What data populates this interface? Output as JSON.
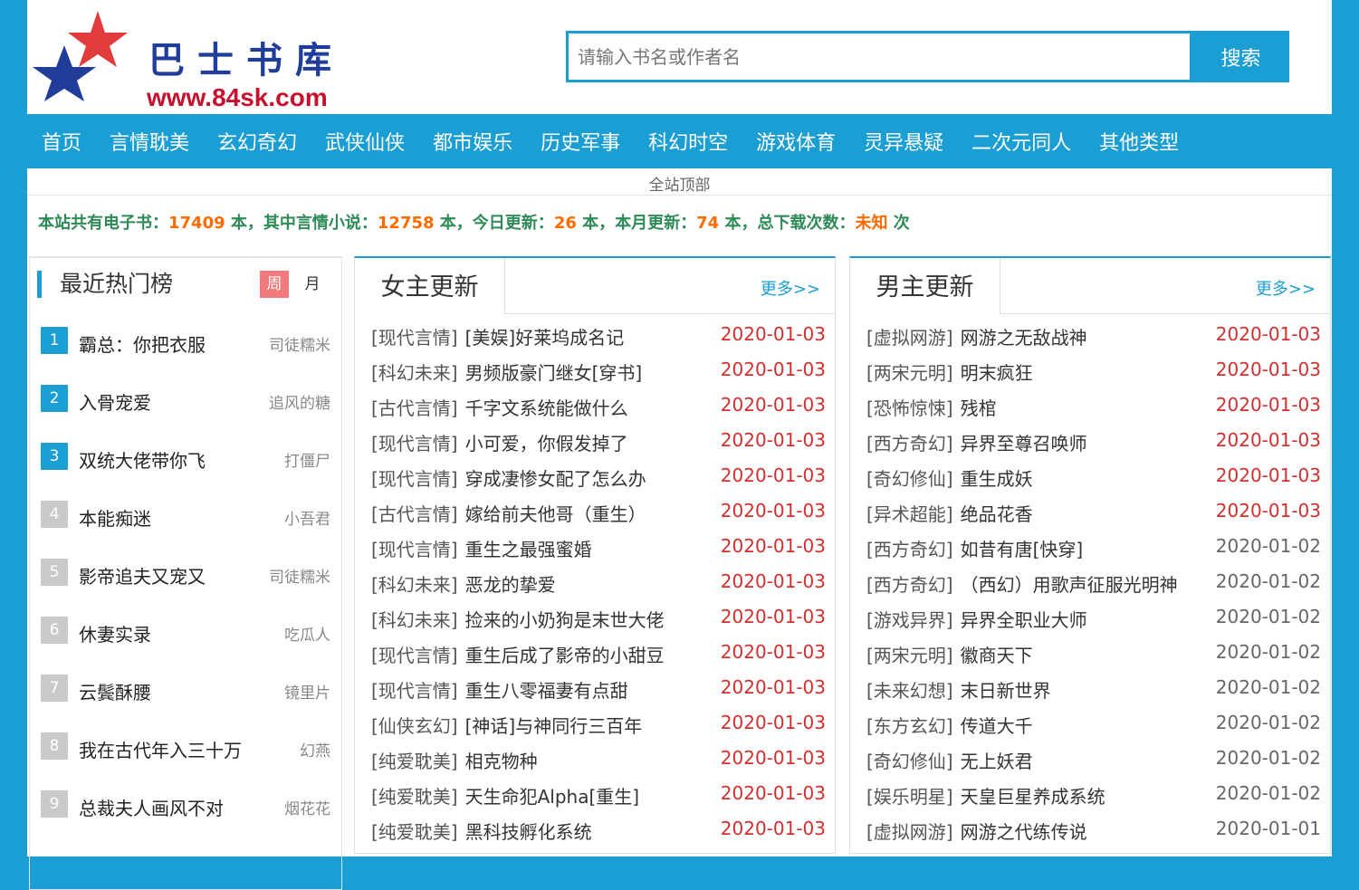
{
  "site": {
    "name": "巴士书库",
    "url": "www.84sk.com"
  },
  "search": {
    "placeholder": "请输入书名或作者名",
    "button": "搜索"
  },
  "nav": [
    "首页",
    "言情耽美",
    "玄幻奇幻",
    "武侠仙侠",
    "都市娱乐",
    "历史军事",
    "科幻时空",
    "游戏体育",
    "灵异悬疑",
    "二次元同人",
    "其他类型"
  ],
  "top_link": "全站顶部",
  "stats": {
    "p1": "本站共有电子书：",
    "total": "17409",
    "p2": " 本，其中言情小说：",
    "romance": "12758",
    "p3": " 本，今日更新：",
    "today": "26",
    "p4": " 本，本月更新：",
    "month": "74",
    "p5": " 本，总下载次数：",
    "downloads": "未知",
    "p6": " 次"
  },
  "hot": {
    "title": "最近热门榜",
    "tab_week": "周",
    "tab_month": "月",
    "items": [
      {
        "rank": "1",
        "book": "霸总：你把衣服",
        "author": "司徒糯米"
      },
      {
        "rank": "2",
        "book": "入骨宠爱",
        "author": "追风的糖"
      },
      {
        "rank": "3",
        "book": "双统大佬带你飞",
        "author": "打僵尸"
      },
      {
        "rank": "4",
        "book": "本能痴迷",
        "author": "小吾君"
      },
      {
        "rank": "5",
        "book": "影帝追夫又宠又",
        "author": "司徒糯米"
      },
      {
        "rank": "6",
        "book": "休妻实录",
        "author": "吃瓜人"
      },
      {
        "rank": "7",
        "book": "云鬓酥腰",
        "author": "镜里片"
      },
      {
        "rank": "8",
        "book": "我在古代年入三十万",
        "author": "幻燕"
      },
      {
        "rank": "9",
        "book": "总裁夫人画风不对",
        "author": "烟花花"
      }
    ]
  },
  "female": {
    "title": "女主更新",
    "more": "更多>>",
    "rows": [
      {
        "cat": "[现代言情]",
        "book": "[美娱]好莱坞成名记",
        "date": "2020-01-03",
        "new": true
      },
      {
        "cat": "[科幻未来]",
        "book": "男频版豪门继女[穿书]",
        "date": "2020-01-03",
        "new": true
      },
      {
        "cat": "[古代言情]",
        "book": "千字文系统能做什么",
        "date": "2020-01-03",
        "new": true
      },
      {
        "cat": "[现代言情]",
        "book": "小可爱，你假发掉了",
        "date": "2020-01-03",
        "new": true
      },
      {
        "cat": "[现代言情]",
        "book": "穿成凄惨女配了怎么办",
        "date": "2020-01-03",
        "new": true
      },
      {
        "cat": "[古代言情]",
        "book": "嫁给前夫他哥（重生）",
        "date": "2020-01-03",
        "new": true
      },
      {
        "cat": "[现代言情]",
        "book": "重生之最强蜜婚",
        "date": "2020-01-03",
        "new": true
      },
      {
        "cat": "[科幻未来]",
        "book": "恶龙的挚爱",
        "date": "2020-01-03",
        "new": true
      },
      {
        "cat": "[科幻未来]",
        "book": "捡来的小奶狗是末世大佬",
        "date": "2020-01-03",
        "new": true
      },
      {
        "cat": "[现代言情]",
        "book": "重生后成了影帝的小甜豆",
        "date": "2020-01-03",
        "new": true
      },
      {
        "cat": "[现代言情]",
        "book": "重生八零福妻有点甜",
        "date": "2020-01-03",
        "new": true
      },
      {
        "cat": "[仙侠玄幻]",
        "book": "[神话]与神同行三百年",
        "date": "2020-01-03",
        "new": true
      },
      {
        "cat": "[纯爱耽美]",
        "book": "相克物种",
        "date": "2020-01-03",
        "new": true
      },
      {
        "cat": "[纯爱耽美]",
        "book": "天生命犯Alpha[重生]",
        "date": "2020-01-03",
        "new": true
      },
      {
        "cat": "[纯爱耽美]",
        "book": "黑科技孵化系统",
        "date": "2020-01-03",
        "new": true
      }
    ]
  },
  "male": {
    "title": "男主更新",
    "more": "更多>>",
    "rows": [
      {
        "cat": "[虚拟网游]",
        "book": "网游之无敌战神",
        "date": "2020-01-03",
        "new": true
      },
      {
        "cat": "[两宋元明]",
        "book": "明末疯狂",
        "date": "2020-01-03",
        "new": true
      },
      {
        "cat": "[恐怖惊悚]",
        "book": "残棺",
        "date": "2020-01-03",
        "new": true
      },
      {
        "cat": "[西方奇幻]",
        "book": "异界至尊召唤师",
        "date": "2020-01-03",
        "new": true
      },
      {
        "cat": "[奇幻修仙]",
        "book": "重生成妖",
        "date": "2020-01-03",
        "new": true
      },
      {
        "cat": "[异术超能]",
        "book": "绝品花香",
        "date": "2020-01-03",
        "new": true
      },
      {
        "cat": "[西方奇幻]",
        "book": "如昔有唐[快穿]",
        "date": "2020-01-02",
        "new": false
      },
      {
        "cat": "[西方奇幻]",
        "book": "（西幻）用歌声征服光明神",
        "date": "2020-01-02",
        "new": false
      },
      {
        "cat": "[游戏异界]",
        "book": "异界全职业大师",
        "date": "2020-01-02",
        "new": false
      },
      {
        "cat": "[两宋元明]",
        "book": "徽商天下",
        "date": "2020-01-02",
        "new": false
      },
      {
        "cat": "[未来幻想]",
        "book": "末日新世界",
        "date": "2020-01-02",
        "new": false
      },
      {
        "cat": "[东方玄幻]",
        "book": "传道大千",
        "date": "2020-01-02",
        "new": false
      },
      {
        "cat": "[奇幻修仙]",
        "book": "无上妖君",
        "date": "2020-01-02",
        "new": false
      },
      {
        "cat": "[娱乐明星]",
        "book": "天皇巨星养成系统",
        "date": "2020-01-02",
        "new": false
      },
      {
        "cat": "[虚拟网游]",
        "book": "网游之代练传说",
        "date": "2020-01-01",
        "new": false
      }
    ]
  },
  "colors": {
    "brand_blue": "#1a9ed3",
    "date_new": "#d32f2f",
    "stats_green": "#2e8b57",
    "stats_orange": "#ff6a00"
  }
}
